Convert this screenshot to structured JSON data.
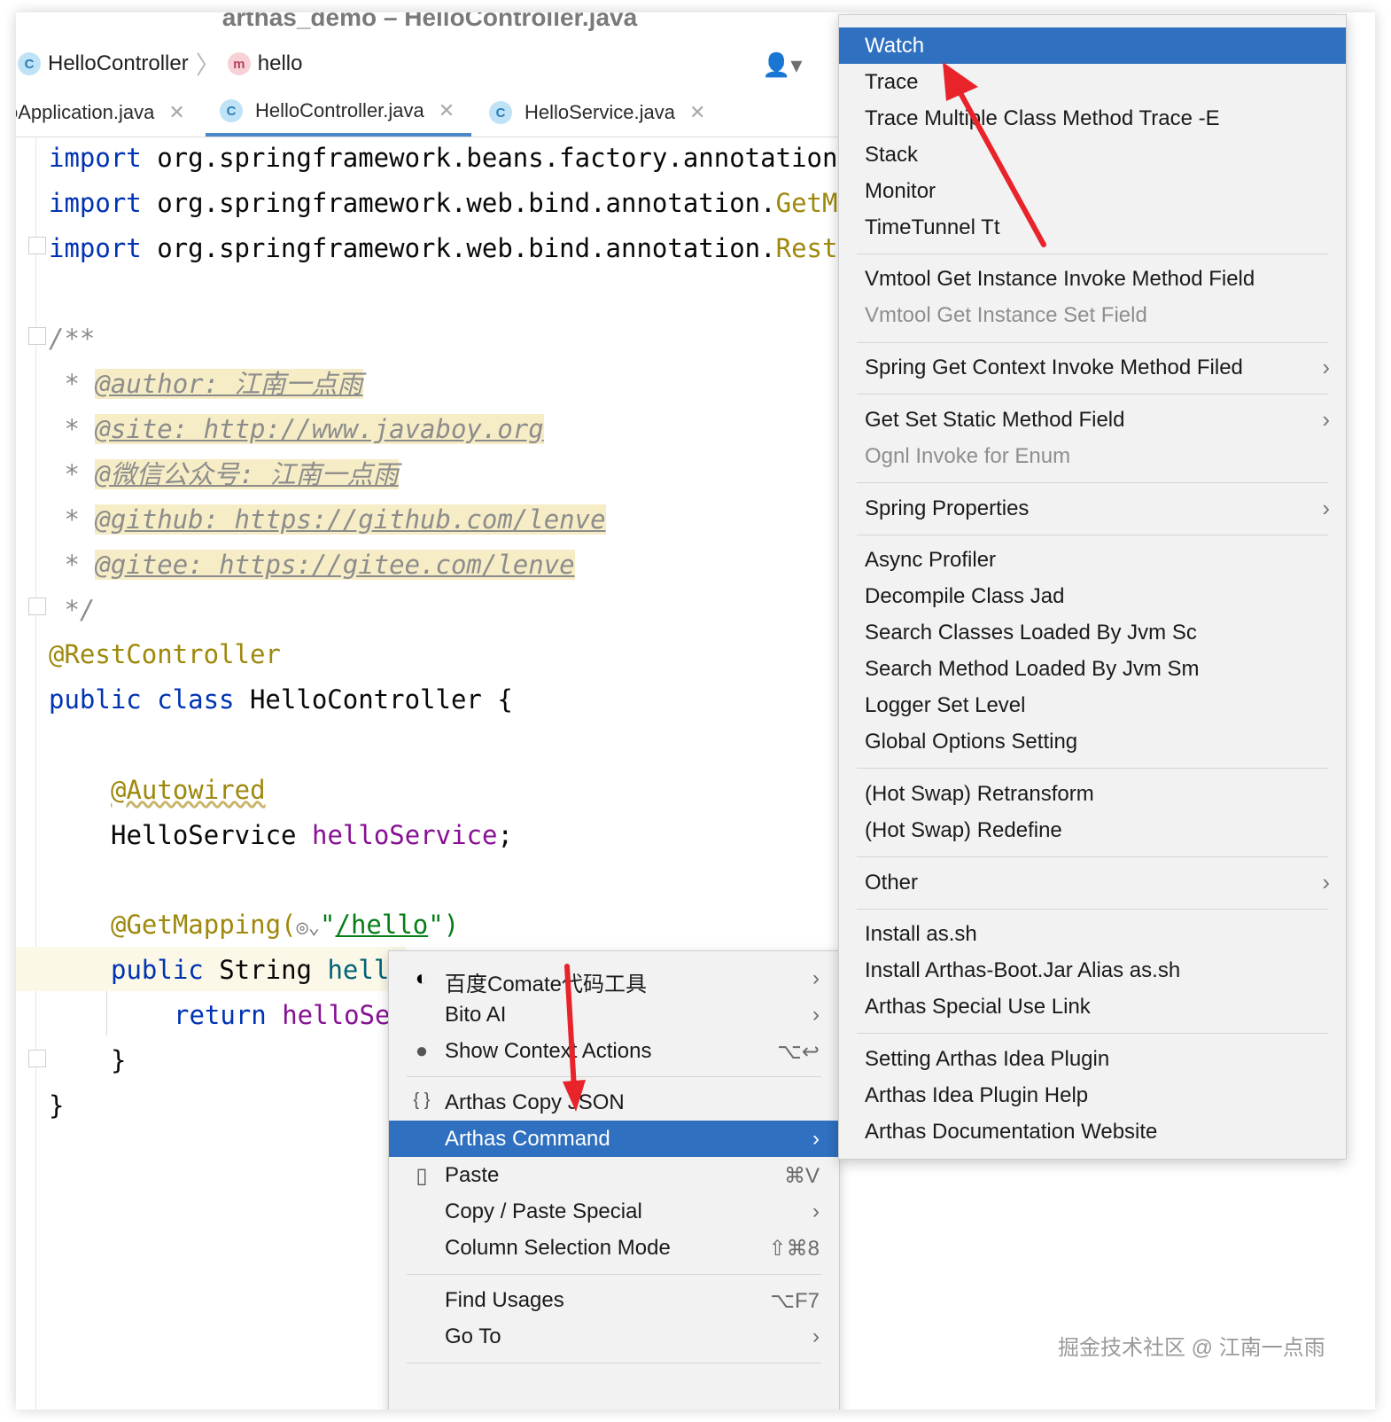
{
  "window": {
    "title": "arthas_demo – HelloController.java"
  },
  "breadcrumb": {
    "class_name": "HelloController",
    "method_name": "hello"
  },
  "tabs": [
    {
      "label": "oApplication.java",
      "active": false
    },
    {
      "label": "HelloController.java",
      "active": true
    },
    {
      "label": "HelloService.java",
      "active": false
    }
  ],
  "code": {
    "imports": [
      {
        "kw": "import",
        "pkg": " org.springframework.beans.factory.annotation",
        "cls": ""
      },
      {
        "kw": "import",
        "pkg": " org.springframework.web.bind.annotation.",
        "cls": "GetM"
      },
      {
        "kw": "import",
        "pkg": " org.springframework.web.bind.annotation.",
        "cls": "Rest"
      }
    ],
    "doc_open": "/**",
    "doc_lines": [
      {
        "star": " * ",
        "tag": "@author: 江南一点雨"
      },
      {
        "star": " * ",
        "tag": "@site: http://www.javaboy.org"
      },
      {
        "star": " * ",
        "tag": "@微信公众号: 江南一点雨"
      },
      {
        "star": " * ",
        "tag": "@github: https://github.com/lenve"
      },
      {
        "star": " * ",
        "tag": "@gitee: https://gitee.com/lenve"
      }
    ],
    "doc_close": " */",
    "class_annotation": "@RestController",
    "class_kw": "public class",
    "class_rest": " HelloController {",
    "field_annotation": "@Autowired",
    "field_type": "HelloService ",
    "field_name": "helloService",
    "field_end": ";",
    "mapping_annotation": "@GetMapping(",
    "mapping_quote_open": "\"",
    "mapping_path": "/hello",
    "mapping_quote_close": "\")",
    "method_kw": "public",
    "method_type": " String ",
    "method_name": "hell",
    "return_kw": "return",
    "return_rest": " helloSe",
    "close_method": "}",
    "close_class": "}"
  },
  "context_menu": {
    "items": [
      {
        "label": "百度Comate代码工具",
        "shortcut": "›",
        "icon": "comate-icon"
      },
      {
        "label": "Bito AI",
        "shortcut": "›",
        "icon": ""
      },
      {
        "label": "Show Context Actions",
        "shortcut": "⌥↩",
        "icon": "bulb-icon"
      },
      {
        "label": "Arthas Copy JSON",
        "shortcut": "",
        "icon": "braces-icon"
      },
      {
        "label": "Arthas Command",
        "shortcut": "›",
        "icon": "",
        "selected": true
      },
      {
        "label": "Paste",
        "shortcut": "⌘V",
        "icon": "clipboard-icon"
      },
      {
        "label": "Copy / Paste Special",
        "shortcut": "›",
        "icon": ""
      },
      {
        "label": "Column Selection Mode",
        "shortcut": "⇧⌘8",
        "icon": ""
      },
      {
        "label": "Find Usages",
        "shortcut": "⌥F7",
        "icon": ""
      },
      {
        "label": "Go To",
        "shortcut": "›",
        "icon": ""
      }
    ]
  },
  "submenu": {
    "items": [
      {
        "label": "Watch",
        "selected": true
      },
      {
        "label": "Trace"
      },
      {
        "label": "Trace Multiple Class Method Trace -E"
      },
      {
        "label": "Stack"
      },
      {
        "label": "Monitor"
      },
      {
        "label": "TimeTunnel Tt"
      },
      {
        "label": "Vmtool Get Instance Invoke Method Field"
      },
      {
        "label": "Vmtool Get Instance Set Field",
        "disabled": true
      },
      {
        "label": "Spring Get Context Invoke Method Filed",
        "submenu": true
      },
      {
        "label": "Get Set Static Method Field",
        "submenu": true
      },
      {
        "label": "Ognl Invoke for Enum",
        "disabled": true
      },
      {
        "label": "Spring Properties",
        "submenu": true
      },
      {
        "label": "Async Profiler"
      },
      {
        "label": "Decompile Class Jad"
      },
      {
        "label": "Search Classes Loaded By Jvm Sc"
      },
      {
        "label": "Search Method Loaded By Jvm Sm"
      },
      {
        "label": "Logger Set Level"
      },
      {
        "label": "Global Options Setting"
      },
      {
        "label": "(Hot Swap) Retransform"
      },
      {
        "label": "(Hot Swap) Redefine"
      },
      {
        "label": "Other",
        "submenu": true
      },
      {
        "label": "Install as.sh"
      },
      {
        "label": "Install Arthas-Boot.Jar Alias as.sh"
      },
      {
        "label": "Arthas Special Use Link"
      },
      {
        "label": "Setting Arthas Idea Plugin"
      },
      {
        "label": "Arthas Idea Plugin Help"
      },
      {
        "label": "Arthas Documentation Website"
      }
    ]
  },
  "watermark": "掘金技术社区 @ 江南一点雨",
  "colors": {
    "selection": "#2f70c0",
    "keyword": "#0033b3",
    "annotation": "#9e880d",
    "arrow": "#e8232a"
  }
}
